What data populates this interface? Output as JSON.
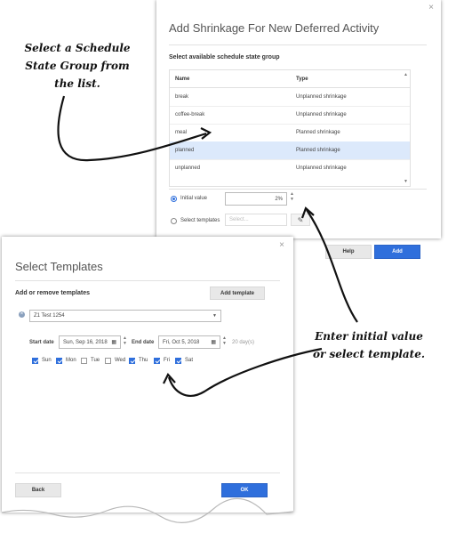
{
  "annotations": {
    "top_left": [
      "Select a Schedule",
      "State Group from",
      "the list."
    ],
    "right": [
      "Enter initial value",
      "or select template."
    ]
  },
  "dialog1": {
    "close": "×",
    "title": "Add Shrinkage For New Deferred Activity",
    "section": "Select available schedule state group",
    "columns": [
      "Name",
      "Type"
    ],
    "rows": [
      {
        "name": "break",
        "type": "Unplanned shrinkage"
      },
      {
        "name": "coffee-break",
        "type": "Unplanned shrinkage"
      },
      {
        "name": "meal",
        "type": "Planned shrinkage"
      },
      {
        "name": "planned",
        "type": "Planned shrinkage"
      },
      {
        "name": "unplanned",
        "type": "Unplanned shrinkage"
      }
    ],
    "selected_row": 3,
    "initial_value_label": "Initial value",
    "initial_value": "2%",
    "select_templates_label": "Select templates",
    "select_templates_placeholder": "Select...",
    "help_label": "Help",
    "add_label": "Add"
  },
  "dialog2": {
    "close": "×",
    "title": "Select Templates",
    "section": "Add or remove templates",
    "add_template_label": "Add template",
    "template_value": "Z1 Test 1254",
    "start_date_label": "Start date",
    "start_date": "Sun, Sep 16, 2018",
    "end_date_label": "End date",
    "end_date": "Fri, Oct 5, 2018",
    "days_count": "20 day(s)",
    "days": [
      {
        "label": "Sun",
        "checked": true
      },
      {
        "label": "Mon",
        "checked": true
      },
      {
        "label": "Tue",
        "checked": false
      },
      {
        "label": "Wed",
        "checked": false
      },
      {
        "label": "Thu",
        "checked": true
      },
      {
        "label": "Fri",
        "checked": true
      },
      {
        "label": "Sat",
        "checked": true
      }
    ],
    "back_label": "Back",
    "ok_label": "OK"
  },
  "colors": {
    "accent": "#2f6fdc",
    "selected_row": "#dce9fb"
  },
  "icons": [
    "close-icon",
    "calendar-icon",
    "pencil-icon",
    "chevron-down-icon",
    "remove-circle-icon",
    "stepper-icon"
  ]
}
